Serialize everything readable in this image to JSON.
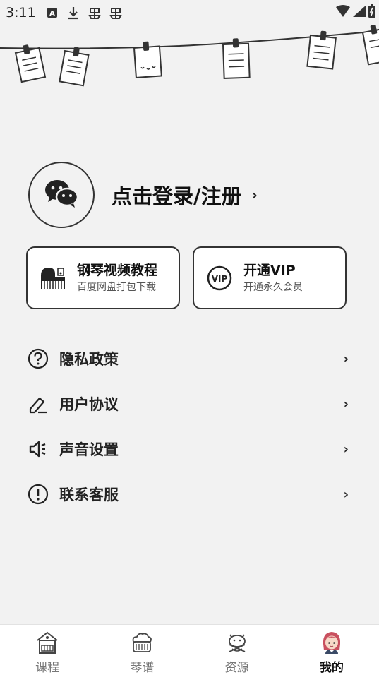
{
  "status_bar": {
    "time": "3:11",
    "icons": [
      "a-notification-icon",
      "download-icon",
      "bug-icon",
      "bug-icon",
      "wifi-icon",
      "signal-icon",
      "battery-icon"
    ]
  },
  "login": {
    "icon": "wechat-icon",
    "label": "点击登录/注册",
    "chevron": "›"
  },
  "cards": [
    {
      "icon": "piano-icon",
      "title": "钢琴视频教程",
      "subtitle": "百度网盘打包下载"
    },
    {
      "icon": "vip-icon",
      "title": "开通VIP",
      "subtitle": "开通永久会员"
    }
  ],
  "menu": [
    {
      "icon": "question-icon",
      "label": "隐私政策",
      "chevron": "›"
    },
    {
      "icon": "edit-icon",
      "label": "用户协议",
      "chevron": "›"
    },
    {
      "icon": "speaker-icon",
      "label": "声音设置",
      "chevron": "›"
    },
    {
      "icon": "exclamation-icon",
      "label": "联系客服",
      "chevron": "›"
    }
  ],
  "bottom_nav": {
    "items": [
      {
        "icon": "piano-house-icon",
        "label": "课程"
      },
      {
        "icon": "piano-cloud-icon",
        "label": "琴谱"
      },
      {
        "icon": "cat-icon",
        "label": "资源"
      },
      {
        "icon": "girl-avatar-icon",
        "label": "我的"
      }
    ],
    "active": "我的"
  },
  "colors": {
    "background": "#f2f2f2",
    "border": "#333333",
    "text": "#222222",
    "nav_inactive": "#777777"
  }
}
